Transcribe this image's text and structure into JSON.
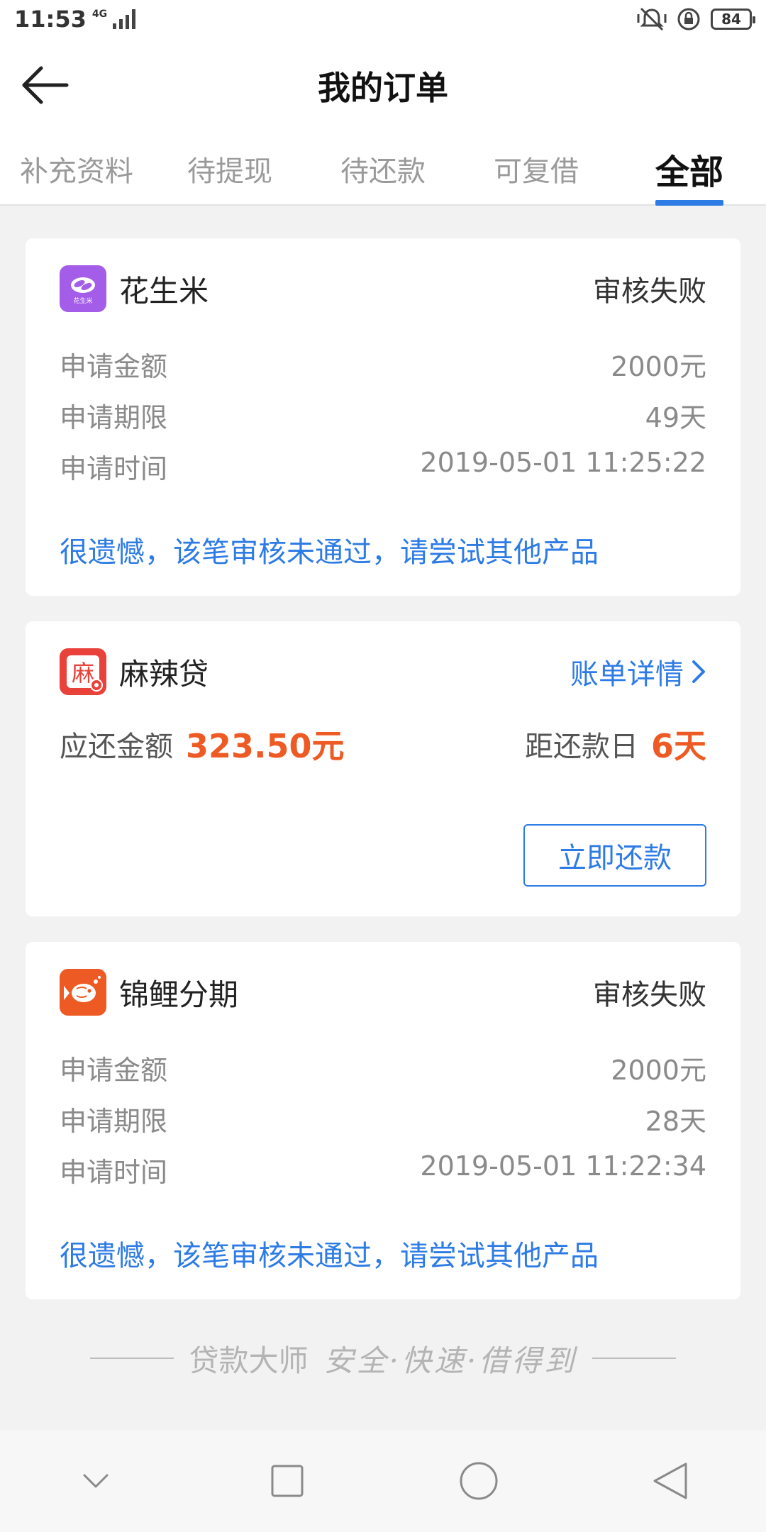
{
  "status_bar": {
    "time": "11:53",
    "network": "4G",
    "battery": "84"
  },
  "header": {
    "title": "我的订单"
  },
  "tabs": [
    {
      "label": "补充资料",
      "active": false
    },
    {
      "label": "待提现",
      "active": false
    },
    {
      "label": "待还款",
      "active": false
    },
    {
      "label": "可复借",
      "active": false
    },
    {
      "label": "全部",
      "active": true
    }
  ],
  "orders": [
    {
      "name": "花生米",
      "logo_text": "花生米",
      "logo_color": "#a35de8",
      "status": "审核失败",
      "rows": [
        {
          "label": "申请金额",
          "value": "2000元"
        },
        {
          "label": "申请期限",
          "value": "49天"
        },
        {
          "label": "申请时间",
          "value": "2019-05-01 11:25:22"
        }
      ],
      "notice": "很遗憾，该笔审核未通过，请尝试其他产品"
    },
    {
      "name": "麻辣贷",
      "logo_text": "麻",
      "logo_color": "#e8423a",
      "detail_link": "账单详情",
      "due_label": "应还金额",
      "due_amount": "323.50元",
      "days_label": "距还款日",
      "days": "6天",
      "button": "立即还款"
    },
    {
      "name": "锦鲤分期",
      "logo_color": "#ee5a24",
      "status": "审核失败",
      "rows": [
        {
          "label": "申请金额",
          "value": "2000元"
        },
        {
          "label": "申请期限",
          "value": "28天"
        },
        {
          "label": "申请时间",
          "value": "2019-05-01 11:22:34"
        }
      ],
      "notice": "很遗憾，该笔审核未通过，请尝试其他产品"
    }
  ],
  "footer": {
    "brand": "贷款大师",
    "motto": "安全·快速·借得到"
  },
  "colors": {
    "accent": "#2d7be5",
    "highlight": "#ee5a24",
    "background": "#f2f2f2"
  }
}
